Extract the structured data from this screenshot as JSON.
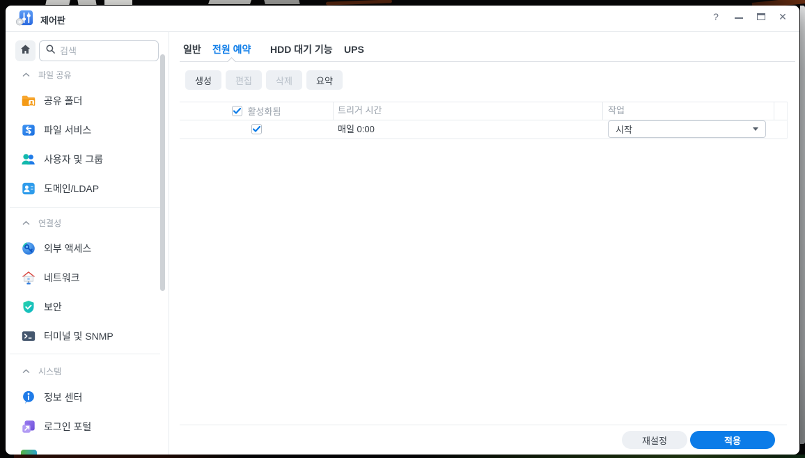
{
  "colors": {
    "accent": "#0c7ce8",
    "tab_active": "#0c7ce8",
    "apply_bg": "#0c7ce8",
    "window_bg": "#ffffff"
  },
  "window": {
    "title": "제어판",
    "controls": {
      "help": "?",
      "close": "✕"
    }
  },
  "sidebar": {
    "search": {
      "placeholder": "검색"
    },
    "sections": [
      {
        "label": "파일 공유",
        "items": [
          {
            "label": "공유 폴더",
            "icon": "shared-folder-icon"
          },
          {
            "label": "파일 서비스",
            "icon": "file-services-icon"
          },
          {
            "label": "사용자 및 그룹",
            "icon": "user-group-icon"
          },
          {
            "label": "도메인/LDAP",
            "icon": "domain-ldap-icon"
          }
        ]
      },
      {
        "label": "연결성",
        "items": [
          {
            "label": "외부 액세스",
            "icon": "external-access-icon"
          },
          {
            "label": "네트워크",
            "icon": "network-icon"
          },
          {
            "label": "보안",
            "icon": "security-icon"
          },
          {
            "label": "터미널 및 SNMP",
            "icon": "terminal-snmp-icon"
          }
        ]
      },
      {
        "label": "시스템",
        "items": [
          {
            "label": "정보 센터",
            "icon": "info-center-icon"
          },
          {
            "label": "로그인 포털",
            "icon": "login-portal-icon"
          }
        ]
      }
    ]
  },
  "main": {
    "tabs": [
      {
        "label": "일반",
        "active": false
      },
      {
        "label": "전원 예약",
        "active": true
      },
      {
        "label": "HDD 대기 기능",
        "active": false
      },
      {
        "label": "UPS",
        "active": false
      }
    ],
    "toolbar": [
      {
        "label": "생성",
        "enabled": true
      },
      {
        "label": "편집",
        "enabled": false
      },
      {
        "label": "삭제",
        "enabled": false
      },
      {
        "label": "요약",
        "enabled": true
      }
    ],
    "table": {
      "headers": [
        "활성화됨",
        "트리거 시간",
        "작업"
      ],
      "rows": [
        {
          "enabled": true,
          "trigger": "매일 0:00",
          "task": "시작"
        }
      ]
    },
    "footer": {
      "reset": "재설정",
      "apply": "적용"
    }
  }
}
